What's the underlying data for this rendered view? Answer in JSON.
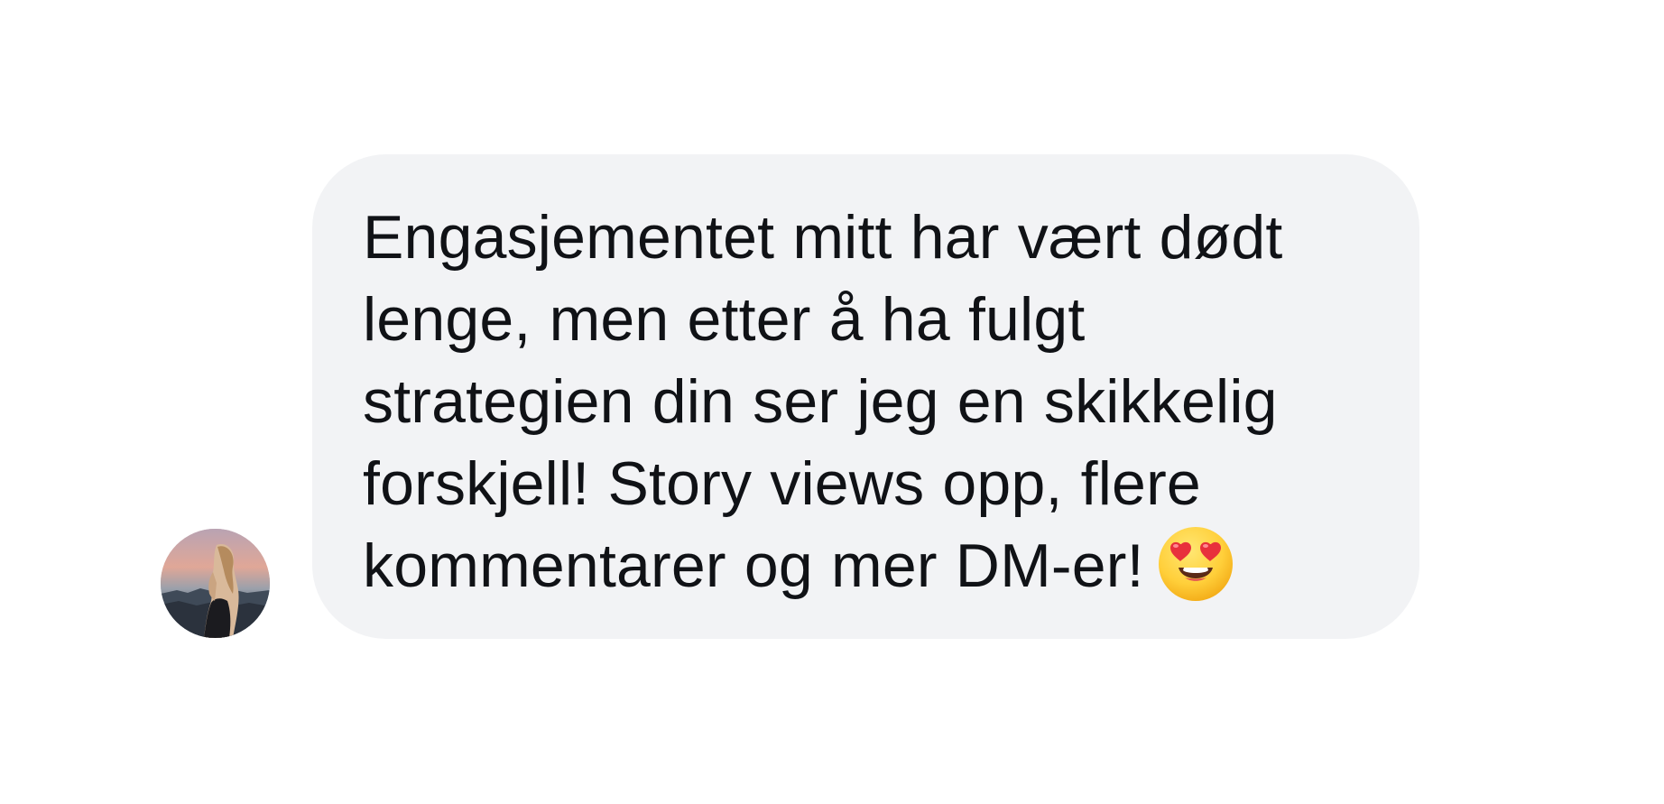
{
  "message": {
    "text": "Engasjementet mitt har vært dødt lenge, men etter å ha fulgt strategien din ser jeg en skikkelig forskjell! Story views opp, flere kommentarer og mer DM-er!",
    "emoji": "smiling-face-with-heart-eyes-icon",
    "bubble_color": "#f2f3f5",
    "text_color": "#101216"
  },
  "sender": {
    "avatar": "avatar-photo"
  }
}
